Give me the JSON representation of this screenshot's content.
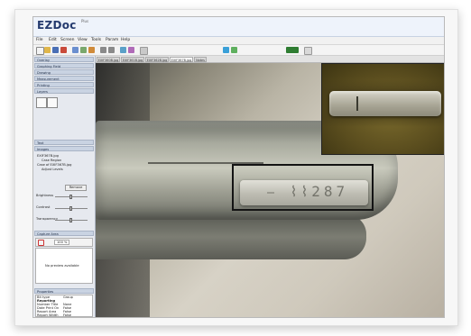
{
  "app": {
    "logo": "EZDoc",
    "logo_suffix": "Plus"
  },
  "menu": [
    "File",
    "Edit",
    "Screen",
    "View",
    "Tools",
    "Param",
    "Help"
  ],
  "toolbar": {
    "icons": [
      "new-icon",
      "open-icon",
      "save-icon",
      "close-icon",
      "capture-icon",
      "zoom-icon",
      "measure-icon",
      "undo-icon",
      "redo-icon",
      "grid-icon",
      "text-icon",
      "palette-icon",
      "settings-icon",
      "help-icon"
    ],
    "accent_color": "#2f7d32"
  },
  "left_panel": {
    "sections": [
      {
        "label": "Overlay"
      },
      {
        "label": "Graphing Field"
      },
      {
        "label": "Drawing"
      },
      {
        "label": "Measurement"
      },
      {
        "label": "Printing"
      },
      {
        "label": "Layers"
      }
    ],
    "text_section": "Text",
    "images_section": "Images",
    "image_tree": [
      "EXIF367B.jpg",
      "Case Region",
      "Case of EXIF367B.jpg",
      "Adjust Levels"
    ],
    "remove_button": "Remove",
    "slider_labels": [
      "Brightness",
      "Contrast",
      "Transparency"
    ],
    "preview_section": "Capture Area",
    "preview_size": "100 %",
    "preview_message": "No preview available",
    "properties_section": "Properties",
    "properties": [
      {
        "key": "Bit type",
        "value": "Group"
      },
      {
        "key": "Reporting",
        "value": ""
      },
      {
        "key": "Number Title",
        "value": "None"
      },
      {
        "key": "Date Print On",
        "value": "False"
      },
      {
        "key": "Report Area",
        "value": "False"
      },
      {
        "key": "Report Width",
        "value": "False"
      }
    ]
  },
  "tabs": [
    "EXIF360B.jpg",
    "EXIF361B.jpg",
    "EXIF362B.jpg",
    "EXIF367B.jpg",
    "Notes"
  ],
  "active_tab": 3
}
